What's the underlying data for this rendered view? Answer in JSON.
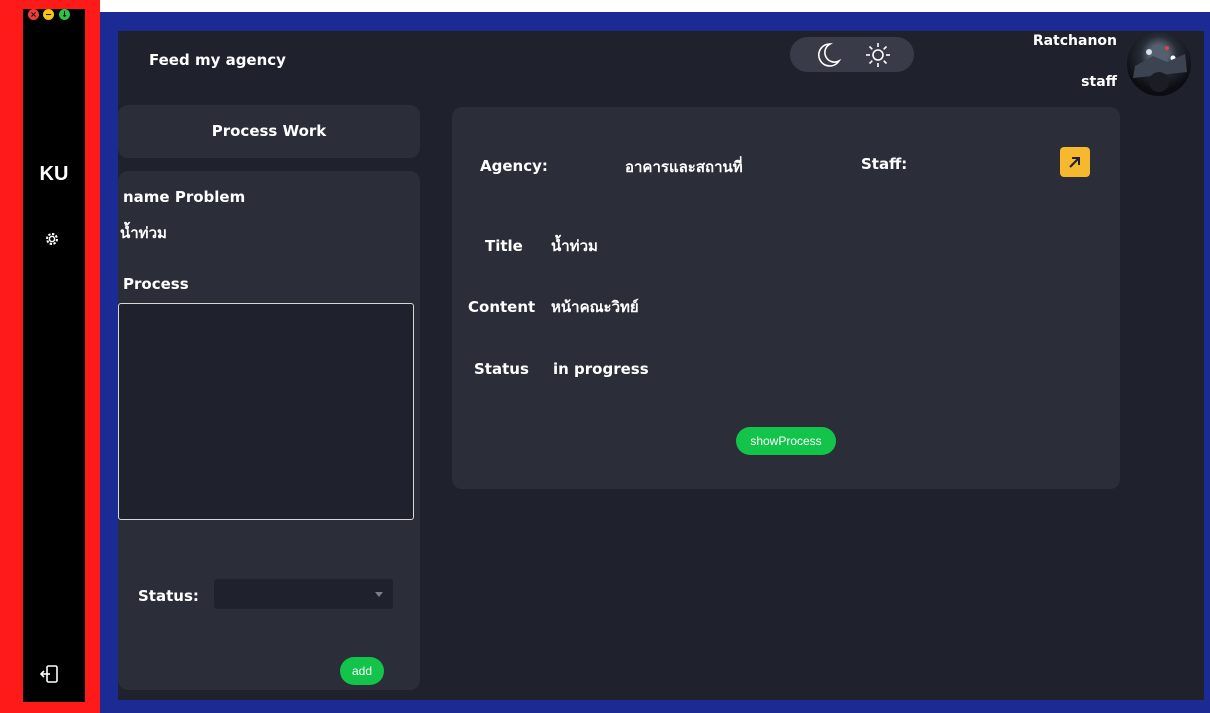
{
  "sidebar": {
    "window_controls": [
      {
        "icon": "close-icon",
        "glyph": "×",
        "color": "#f03c3c"
      },
      {
        "icon": "minimize-icon",
        "glyph": "−",
        "color": "#f5c518"
      },
      {
        "icon": "maximize-icon",
        "glyph": "↓",
        "color": "#2ec24a"
      }
    ],
    "logo": "KU",
    "settings_icon": "gear-icon",
    "logout_icon": "logout-icon"
  },
  "header": {
    "app_title": "Feed my agency",
    "theme_toggle": {
      "dark_icon": "moon-icon",
      "light_icon": "sun-icon"
    },
    "user": {
      "name": "Ratchanon",
      "role": "staff",
      "avatar_icon": "avatar"
    }
  },
  "process_panel": {
    "title": "Process Work",
    "name_label": "name Problem",
    "name_value": "น้ำท่วม",
    "process_label": "Process",
    "process_value": "",
    "status_label": "Status:",
    "status_value": "",
    "add_button": "add"
  },
  "detail_panel": {
    "agency_label": "Agency:",
    "agency_value": "อาคารและสถานที่",
    "staff_label": "Staff:",
    "open_icon": "arrow-up-right-icon",
    "title_label": "Title",
    "title_value": "น้ำท่วม",
    "content_label": "Content",
    "content_value": "หน้าคณะวิทย์",
    "status_label": "Status",
    "status_value": "in progress",
    "show_button": "showProcess"
  },
  "colors": {
    "frame_red": "#ff1a1a",
    "frame_blue": "#1c2b94",
    "app_bg": "#1f212c",
    "card_bg": "#2b2d39",
    "accent_green": "#13c44a",
    "accent_yellow": "#f5b82e"
  }
}
